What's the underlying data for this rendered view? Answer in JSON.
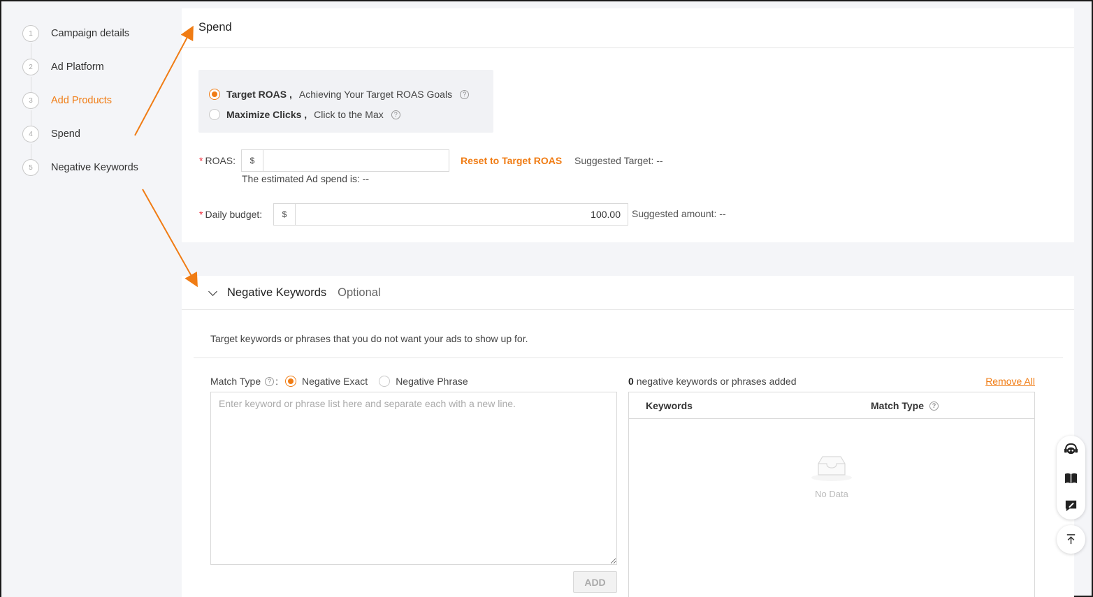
{
  "steps": [
    {
      "num": "1",
      "label": "Campaign details"
    },
    {
      "num": "2",
      "label": "Ad Platform"
    },
    {
      "num": "3",
      "label": "Add Products"
    },
    {
      "num": "4",
      "label": "Spend"
    },
    {
      "num": "5",
      "label": "Negative Keywords"
    }
  ],
  "spend": {
    "title": "Spend",
    "bid_options": [
      {
        "strong": "Target ROAS ,",
        "desc": "Achieving Your Target ROAS Goals",
        "checked": true
      },
      {
        "strong": "Maximize Clicks ,",
        "desc": "Click to the Max",
        "checked": false
      }
    ],
    "roas_label": "ROAS",
    "roas_prefix": "$",
    "roas_value": "",
    "reset_link": "Reset to Target ROAS",
    "suggested_target": "Suggested Target: --",
    "estimated_spend": "The estimated Ad spend is: --",
    "budget_label": "Daily budget",
    "budget_prefix": "$",
    "budget_value": "100.00",
    "suggested_amount": "Suggested amount: --"
  },
  "negative": {
    "title": "Negative Keywords",
    "optional": "Optional",
    "description": "Target keywords or phrases that you do not want your ads to show up for.",
    "match_type_label": "Match Type",
    "match_options": [
      {
        "label": "Negative Exact",
        "checked": true
      },
      {
        "label": "Negative Phrase",
        "checked": false
      }
    ],
    "textarea_placeholder": "Enter keyword or phrase list here and separate each with a new line.",
    "add_button": "ADD",
    "count": "0",
    "count_suffix": "negative keywords or phrases added",
    "remove_all": "Remove All",
    "table_headers": [
      "Keywords",
      "Match Type"
    ],
    "empty_text": "No Data"
  },
  "colors": {
    "accent": "#f07c14",
    "required": "#e22233"
  },
  "icons": [
    "help-icon",
    "chevron-down-icon",
    "empty-inbox-icon",
    "robot-assistant-icon",
    "book-icon",
    "feedback-icon",
    "back-to-top-icon"
  ]
}
